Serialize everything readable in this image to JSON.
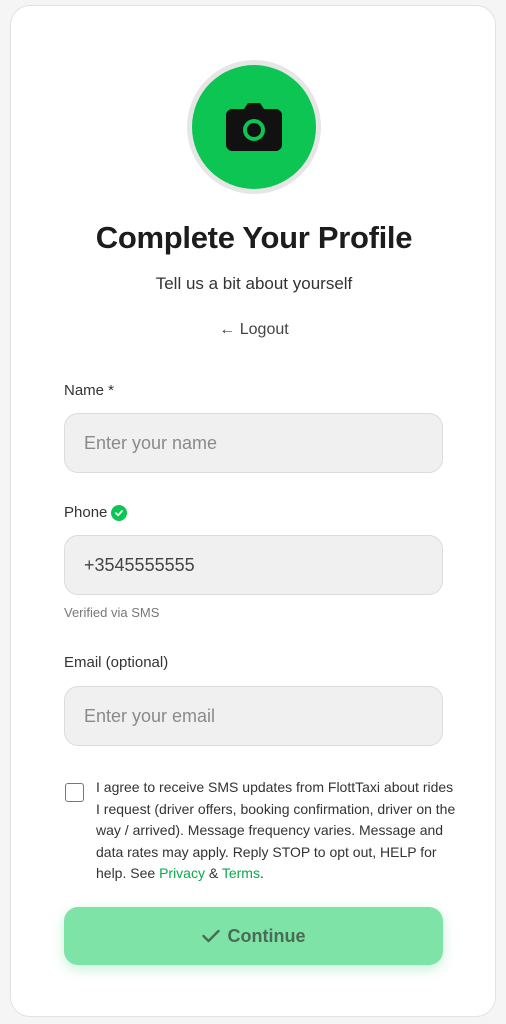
{
  "header": {
    "title": "Complete Your Profile",
    "subtitle": "Tell us a bit about yourself",
    "logout_label": "← Logout",
    "avatar_icon": "camera-icon"
  },
  "form": {
    "name": {
      "label": "Name *",
      "placeholder": "Enter your name",
      "value": ""
    },
    "phone": {
      "label": "Phone",
      "value": "+3545555555",
      "verified_icon": "check-circle-icon",
      "helper": "Verified via SMS"
    },
    "email": {
      "label": "Email (optional)",
      "placeholder": "Enter your email",
      "value": ""
    },
    "consent": {
      "checked": false,
      "text_before": "I agree to receive SMS updates from FlottTaxi about rides I request (driver offers, booking confirmation, driver on the way / arrived). Message frequency varies. Message and data rates may apply. Reply STOP to opt out, HELP for help. See ",
      "privacy_label": "Privacy",
      "and": " & ",
      "terms_label": "Terms",
      "text_after": "."
    },
    "submit": {
      "label": "Continue",
      "icon": "checkmark-icon"
    }
  },
  "colors": {
    "accent": "#0cc552",
    "button_bg": "#7ee3a6",
    "link": "#0aa84a",
    "input_bg": "#f0f0f0"
  }
}
